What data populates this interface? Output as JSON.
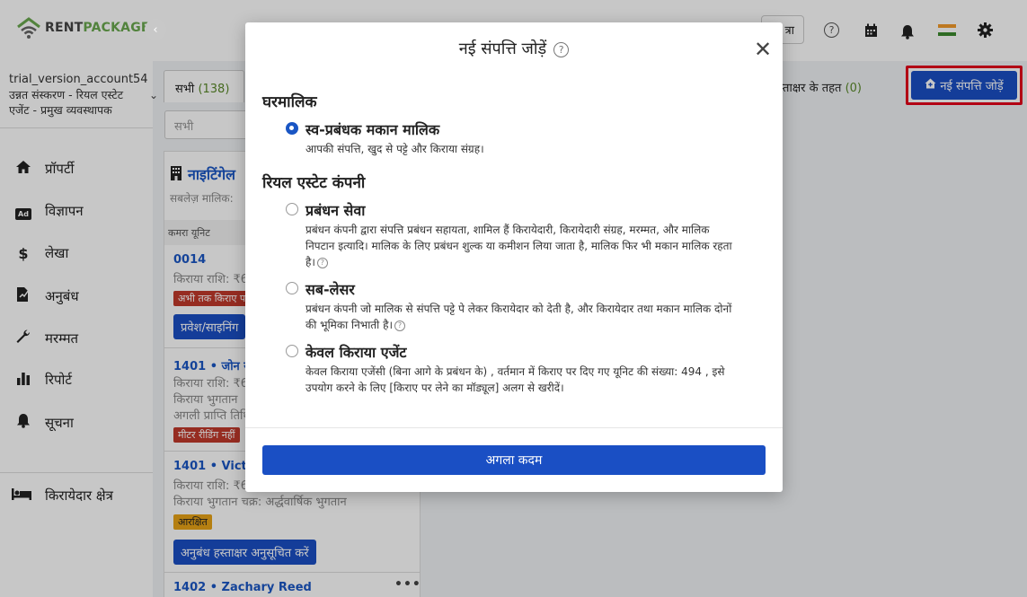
{
  "brand": {
    "logo_word1": "RENT",
    "logo_word2": "PACKAGE"
  },
  "account": {
    "name": "trial_version_account54",
    "edition": "उन्नत संस्करण - रियल एस्टेट",
    "role": "एजेंट - प्रमुख व्यवस्थापक"
  },
  "sidebar": {
    "items": [
      {
        "label": "प्रॉपर्टी",
        "icon": "home-icon"
      },
      {
        "label": "विज्ञापन",
        "icon": "ad-icon",
        "badge": "Ad"
      },
      {
        "label": "लेखा",
        "icon": "dollar-icon"
      },
      {
        "label": "अनुबंध",
        "icon": "contract-icon"
      },
      {
        "label": "मरम्मत",
        "icon": "wrench-icon"
      },
      {
        "label": "रिपोर्ट",
        "icon": "bar-chart-icon"
      },
      {
        "label": "सूचना",
        "icon": "bell-icon"
      }
    ],
    "tenant_area": "किरायेदार क्षेत्र"
  },
  "topbar": {
    "partial_button": "त्रा"
  },
  "tabs": {
    "all": "सभी",
    "all_count": "(138)",
    "signed": "स्ताक्षर के तहत",
    "signed_count": "(0)"
  },
  "toolbar": {
    "new_property": "नई संपत्ति जोड़ें"
  },
  "filter": {
    "placeholder": "सभी"
  },
  "list": {
    "building": "नाइटिंगेल",
    "owner": "सबलेज़ मालिक:",
    "column_header": "कमरा यूनिट",
    "rows": [
      {
        "unit": "0014",
        "rent": "किराया राशि: ₹6",
        "tag": "अभी तक किराए प",
        "button": "प्रवेश/साइनिंग"
      },
      {
        "unit": "1401 • ",
        "name": "जोन रो",
        "rent": "किराया राशि: ₹6",
        "cycle": "किराया भुगतान",
        "next": "अगली प्राप्ति तिथि",
        "tag": "मीटर रीडिंग नहीं"
      },
      {
        "unit": "1401 • ",
        "name": "Victor",
        "rent": "किराया राशि: ₹6",
        "cycle": "किराया भुगतान चक्र: अर्द्धवार्षिक भुगतान",
        "tag": "आरक्षित",
        "button": "अनुबंध हस्ताक्षर अनुसूचित करें"
      },
      {
        "unit": "1402 • ",
        "name": "Zachary Reed"
      }
    ]
  },
  "modal": {
    "title": "नई संपत्ति जोड़ें",
    "help": "?",
    "section_owner": "घरमालिक",
    "section_company": "रियल एस्टेट कंपनी",
    "options": [
      {
        "label": "स्व-प्रबंधक मकान मालिक",
        "desc": "आपकी संपत्ति, खुद से पट्टे और किराया संग्रह।",
        "checked": true
      },
      {
        "label": "प्रबंधन सेवा",
        "desc": "प्रबंधन कंपनी द्वारा संपत्ति प्रबंधन सहायता, शामिल हैं किरायेदारी, किरायेदारी संग्रह, मरम्मत, और मालिक निपटान इत्यादि। मालिक के लिए प्रबंधन शुल्क या कमीशन लिया जाता है, मालिक फिर भी मकान मालिक रहता है।",
        "checked": false
      },
      {
        "label": "सब-लेसर",
        "desc": "प्रबंधन कंपनी जो मालिक से संपत्ति पट्टे पे लेकर किरायेदार को देती है, और किरायेदार तथा मकान मालिक दोनों की भूमिका निभाती है।",
        "checked": false
      },
      {
        "label": "केवल किराया एजेंट",
        "desc": "केवल किराया एजेंसी (बिना आगे के प्रबंधन के) , वर्तमान में किराए पर दिए गए यूनिट की संख्या: 494 , इसे उपयोग करने के लिए [किराए पर लेने का मॉड्यूल] अलग से खरीदें।",
        "checked": false
      }
    ],
    "next_button": "अगला कदम"
  },
  "colors": {
    "primary": "#1a4fc4",
    "highlight": "#e5001a",
    "brand_green": "#6aa84f"
  }
}
